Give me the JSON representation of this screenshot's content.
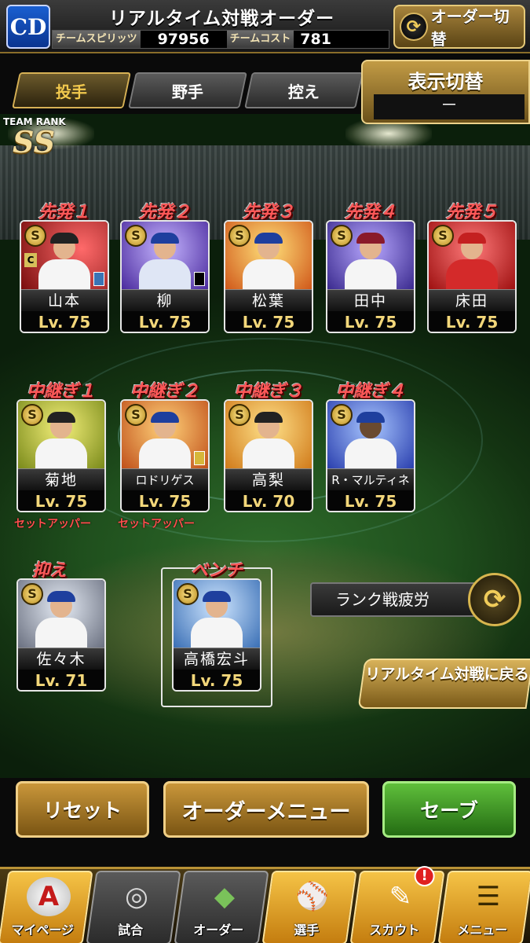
{
  "header": {
    "team_logo": "CD",
    "title": "リアルタイム対戦オーダー",
    "spirits_label": "チームスピリッツ",
    "spirits_value": "97956",
    "cost_label": "チームコスト",
    "cost_value": "781",
    "order_switch_label": "オーダー切替",
    "order_switch_icon": "cycle-arrows-icon"
  },
  "tabs": [
    {
      "label": "投手",
      "active": true
    },
    {
      "label": "野手",
      "active": false
    },
    {
      "label": "控え",
      "active": false
    }
  ],
  "display_switch": {
    "title": "表示切替",
    "value": "－"
  },
  "team_rank": {
    "caption": "TEAM RANK",
    "rank": "SS"
  },
  "starters": [
    {
      "role": "先発１",
      "name": "山本",
      "level": "Lv. 75",
      "badge": "S",
      "accent": "#b01e1e",
      "cap": "#222222"
    },
    {
      "role": "先発２",
      "name": "柳",
      "level": "Lv. 75",
      "badge": "S",
      "accent": "#6a3fb5",
      "cap": "#1e3f9e"
    },
    {
      "role": "先発３",
      "name": "松葉",
      "level": "Lv. 75",
      "badge": "S",
      "accent": "#e08a1a",
      "cap": "#1e3f9e"
    },
    {
      "role": "先発４",
      "name": "田中",
      "level": "Lv. 75",
      "badge": "S",
      "accent": "#4a3fb5",
      "cap": "#8a1a2a"
    },
    {
      "role": "先発５",
      "name": "床田",
      "level": "Lv. 75",
      "badge": "S",
      "accent": "#c42020",
      "cap": "#c42020"
    }
  ],
  "relievers": [
    {
      "role": "中継ぎ１",
      "name": "菊地",
      "level": "Lv. 75",
      "badge": "S",
      "accent": "#c9c23a",
      "cap": "#222222",
      "note": "セットアッパー"
    },
    {
      "role": "中継ぎ２",
      "name": "ロドリゲス",
      "level": "Lv. 75",
      "badge": "S",
      "accent": "#e07a1a",
      "cap": "#1e3f9e",
      "note": "セットアッパー"
    },
    {
      "role": "中継ぎ３",
      "name": "高梨",
      "level": "Lv. 70",
      "badge": "S",
      "accent": "#e0a21a",
      "cap": "#222222",
      "note": ""
    },
    {
      "role": "中継ぎ４",
      "name": "R・マルティネス",
      "level": "Lv. 75",
      "badge": "S",
      "accent": "#3a5fd0",
      "cap": "#1e3f9e",
      "note": ""
    }
  ],
  "closer": {
    "role": "抑え",
    "name": "佐々木",
    "level": "Lv. 71",
    "badge": "S",
    "accent": "#8a8f9a",
    "cap": "#1e3f9e"
  },
  "bench": {
    "role": "ベンチ",
    "name": "高橋宏斗",
    "level": "Lv. 75",
    "badge": "S",
    "accent": "#4a8fd0",
    "cap": "#1e3f9e"
  },
  "side": {
    "rank_fatigue": "ランク戦疲労",
    "back_to_realtime": "リアルタイム対戦に戻る"
  },
  "actions": {
    "reset": "リセット",
    "order_menu": "オーダーメニュー",
    "save": "セーブ"
  },
  "nav": [
    {
      "label": "マイページ",
      "icon": "letter-a-icon"
    },
    {
      "label": "試合",
      "icon": "stadium-icon"
    },
    {
      "label": "オーダー",
      "icon": "field-icon"
    },
    {
      "label": "選手",
      "icon": "batter-icon"
    },
    {
      "label": "スカウト",
      "icon": "signed-ball-icon",
      "alert": "!"
    },
    {
      "label": "メニュー",
      "icon": "menu-icon"
    }
  ]
}
